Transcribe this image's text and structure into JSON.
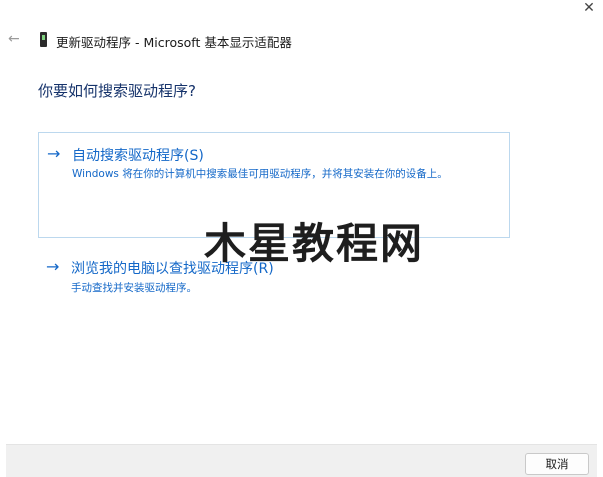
{
  "window": {
    "close_label": "✕",
    "back_label": "←",
    "title": "更新驱动程序 - Microsoft 基本显示适配器"
  },
  "main": {
    "heading": "你要如何搜索驱动程序?",
    "options": [
      {
        "arrow": "→",
        "title": "自动搜索驱动程序(S)",
        "description": "Windows 将在你的计算机中搜索最佳可用驱动程序，并将其安装在你的设备上。"
      },
      {
        "arrow": "→",
        "title": "浏览我的电脑以查找驱动程序(R)",
        "description": "手动查找并安装驱动程序。"
      }
    ]
  },
  "watermark": "木星教程网",
  "footer": {
    "cancel_label": "取消"
  },
  "colors": {
    "accent": "#1468c8",
    "heading": "#16336b",
    "selected_border": "#bcd8ee",
    "footer_bg": "#f0f0f0"
  },
  "icons": {
    "device": "device-icon",
    "back": "back-arrow-icon",
    "close": "close-icon",
    "option_arrow": "arrow-right-icon"
  }
}
